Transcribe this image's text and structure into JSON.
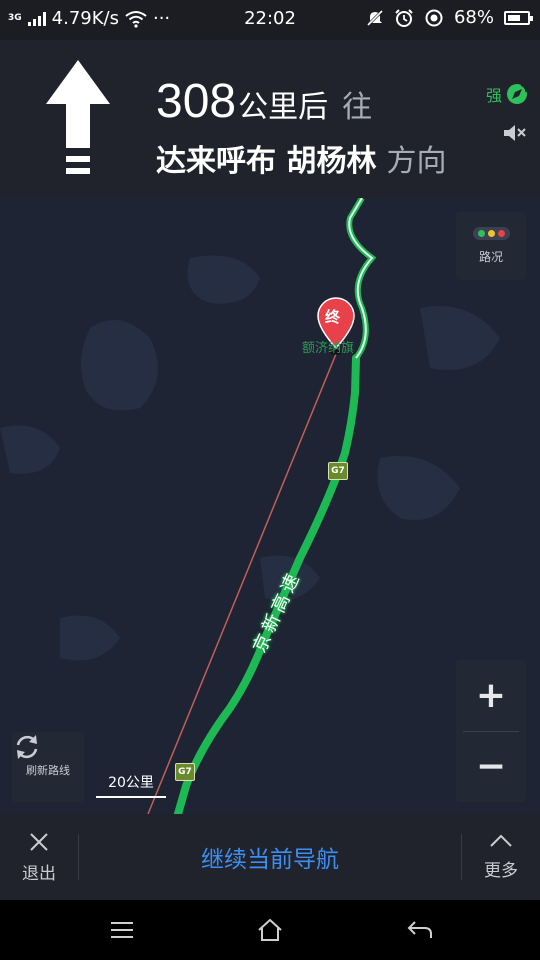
{
  "status_bar": {
    "network_type": "3G",
    "speed": "4.79K/s",
    "more_dots": "···",
    "time": "22:02",
    "battery": "68%",
    "battery_level": 0.68
  },
  "nav_header": {
    "distance_value": "308",
    "distance_unit": "公里后",
    "toward_label": "往",
    "destination": "达来呼布 胡杨林",
    "direction_label": "方向",
    "gps_label": "强",
    "icons": {
      "turn": "straight-arrow-icon",
      "gps": "gps-signal-icon",
      "sound": "mute-icon"
    }
  },
  "map": {
    "end_marker_label": "终",
    "road_name": "京新高速",
    "highway_shield_top": "G7",
    "highway_shield_bottom": "G7",
    "place_label": "额济纳旗",
    "traffic_label": "路况",
    "zoom_in": "+",
    "zoom_out": "−",
    "refresh_label": "刷新路线",
    "scale_label": "20公里",
    "colors": {
      "background": "#1e2433",
      "route": "#1db954",
      "straight_line": "#c0605a",
      "marker": "#e8414a"
    }
  },
  "action_bar": {
    "exit_label": "退出",
    "continue_label": "继续当前导航",
    "more_label": "更多",
    "accent_color": "#3d8ef2"
  },
  "system_nav": {
    "icons": [
      "menu-icon",
      "home-icon",
      "back-icon"
    ]
  }
}
